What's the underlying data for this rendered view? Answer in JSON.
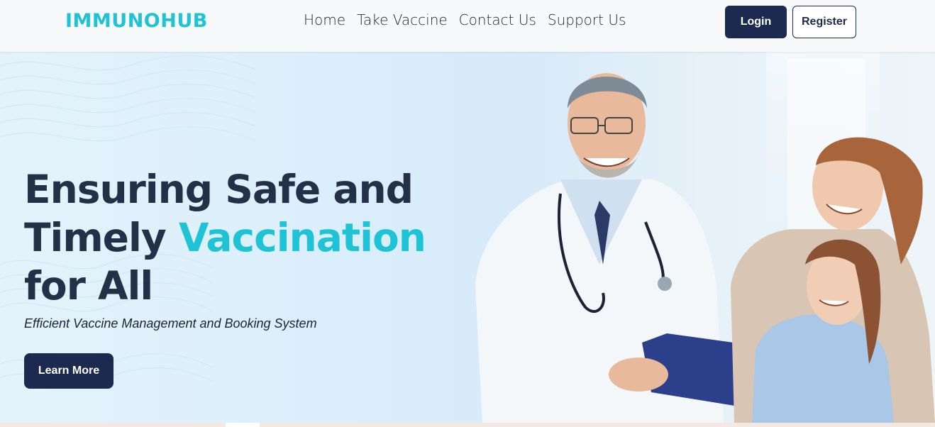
{
  "brand": {
    "name": "IMMUNOHUB"
  },
  "nav": {
    "links": [
      "Home",
      "Take Vaccine",
      "Contact Us",
      "Support Us"
    ],
    "login_label": "Login",
    "register_label": "Register"
  },
  "hero": {
    "headline_line1": "Ensuring Safe and",
    "headline_line2_start": "Timely ",
    "headline_line2_accent": "Vaccination",
    "headline_line3": "for All",
    "subtitle": "Efficient Vaccine Management and Booking System",
    "cta_label": "Learn More"
  },
  "colors": {
    "accent": "#1ec3d6",
    "primary": "#1c2a4f",
    "headline": "#233048"
  }
}
